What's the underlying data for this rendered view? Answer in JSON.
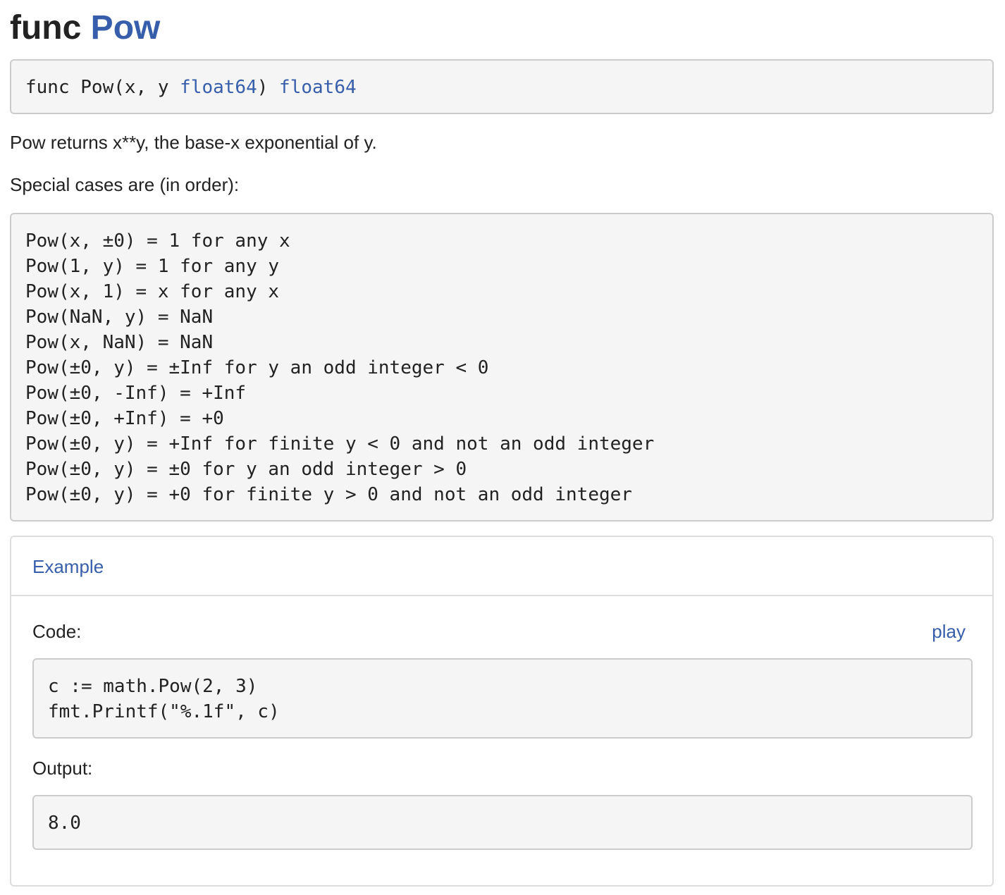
{
  "heading": {
    "keyword": "func",
    "name": "Pow"
  },
  "signature": {
    "prefix": "func Pow(x, y ",
    "param_type": "float64",
    "middle": ") ",
    "return_type": "float64"
  },
  "doc": {
    "summary": "Pow returns x**y, the base-x exponential of y.",
    "special_cases_intro": "Special cases are (in order):"
  },
  "special_cases": [
    "Pow(x, ±0) = 1 for any x",
    "Pow(1, y) = 1 for any y",
    "Pow(x, 1) = x for any x",
    "Pow(NaN, y) = NaN",
    "Pow(x, NaN) = NaN",
    "Pow(±0, y) = ±Inf for y an odd integer < 0",
    "Pow(±0, -Inf) = +Inf",
    "Pow(±0, +Inf) = +0",
    "Pow(±0, y) = +Inf for finite y < 0 and not an odd integer",
    "Pow(±0, y) = ±0 for y an odd integer > 0",
    "Pow(±0, y) = +0 for finite y > 0 and not an odd integer"
  ],
  "example": {
    "title": "Example",
    "code_label": "Code:",
    "play_label": "play",
    "code_lines": [
      "c := math.Pow(2, 3)",
      "fmt.Printf(\"%.1f\", c)"
    ],
    "output_label": "Output:",
    "output_lines": [
      "8.0"
    ]
  },
  "colors": {
    "link": "#375eab",
    "text": "#222222",
    "code_background": "#f5f5f5",
    "border": "#cccccc"
  }
}
